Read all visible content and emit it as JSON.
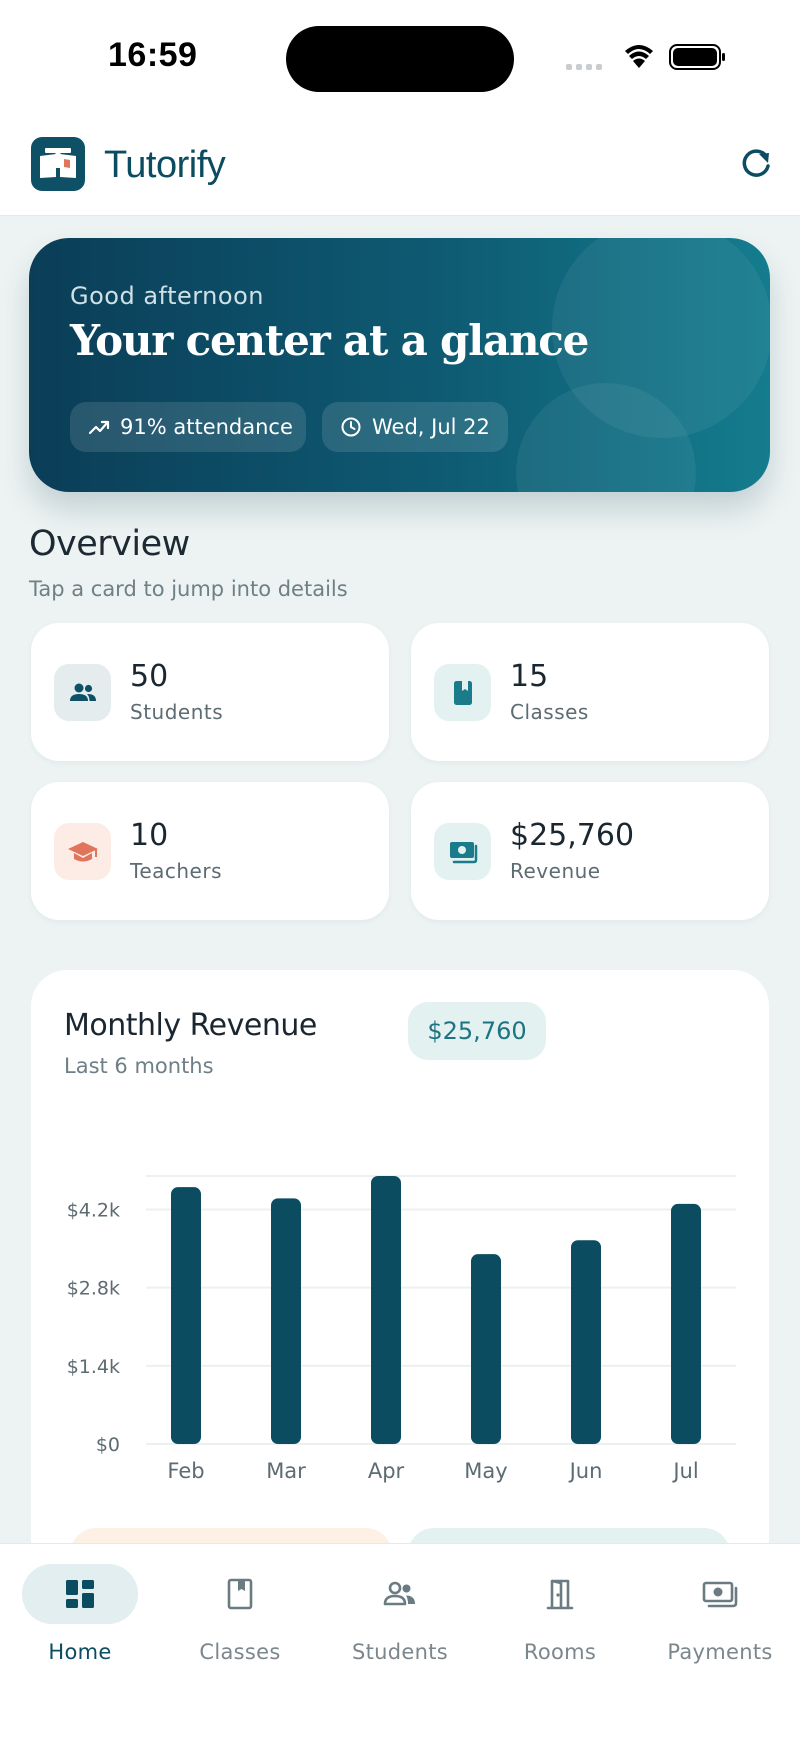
{
  "status_bar": {
    "time": "16:59"
  },
  "header": {
    "app_name": "Tutorify"
  },
  "hero": {
    "greeting": "Good afternoon",
    "title": "Your center at a glance",
    "attendance": "91% attendance",
    "date": "Wed, Jul 22"
  },
  "overview": {
    "title": "Overview",
    "subtitle": "Tap a card to jump into details",
    "stats": [
      {
        "value": "50",
        "label": "Students",
        "icon": "people-icon",
        "color": "#0e5166",
        "bg": "#e4eced"
      },
      {
        "value": "15",
        "label": "Classes",
        "icon": "book-icon",
        "color": "#1a7c8a",
        "bg": "#e3f1f1"
      },
      {
        "value": "10",
        "label": "Teachers",
        "icon": "graduation-cap-icon",
        "color": "#e0755b",
        "bg": "#fdebe5"
      },
      {
        "value": "$25,760",
        "label": "Revenue",
        "icon": "cash-icon",
        "color": "#1a7c8a",
        "bg": "#e3f1f1"
      }
    ]
  },
  "revenue": {
    "title": "Monthly Revenue",
    "subtitle": "Last 6 months",
    "total": "$25,760"
  },
  "chart_data": {
    "type": "bar",
    "categories": [
      "Feb",
      "Mar",
      "Apr",
      "May",
      "Jun",
      "Jul"
    ],
    "values": [
      4600,
      4400,
      4800,
      3400,
      3650,
      4300
    ],
    "yticks": [
      "$0",
      "$1.4k",
      "$2.8k",
      "$4.2k"
    ],
    "ytick_values": [
      0,
      1400,
      2800,
      4200
    ],
    "ylim": [
      0,
      4800
    ],
    "bar_color": "#0c4c61"
  },
  "nav": [
    {
      "label": "Home",
      "icon": "dashboard-icon",
      "active": true
    },
    {
      "label": "Classes",
      "icon": "book-icon",
      "active": false
    },
    {
      "label": "Students",
      "icon": "people-icon",
      "active": false
    },
    {
      "label": "Rooms",
      "icon": "door-icon",
      "active": false
    },
    {
      "label": "Payments",
      "icon": "cash-icon",
      "active": false
    }
  ],
  "colors": {
    "brand": "#0c4c61",
    "accent": "#1a7c8a",
    "background": "#edf3f3"
  }
}
